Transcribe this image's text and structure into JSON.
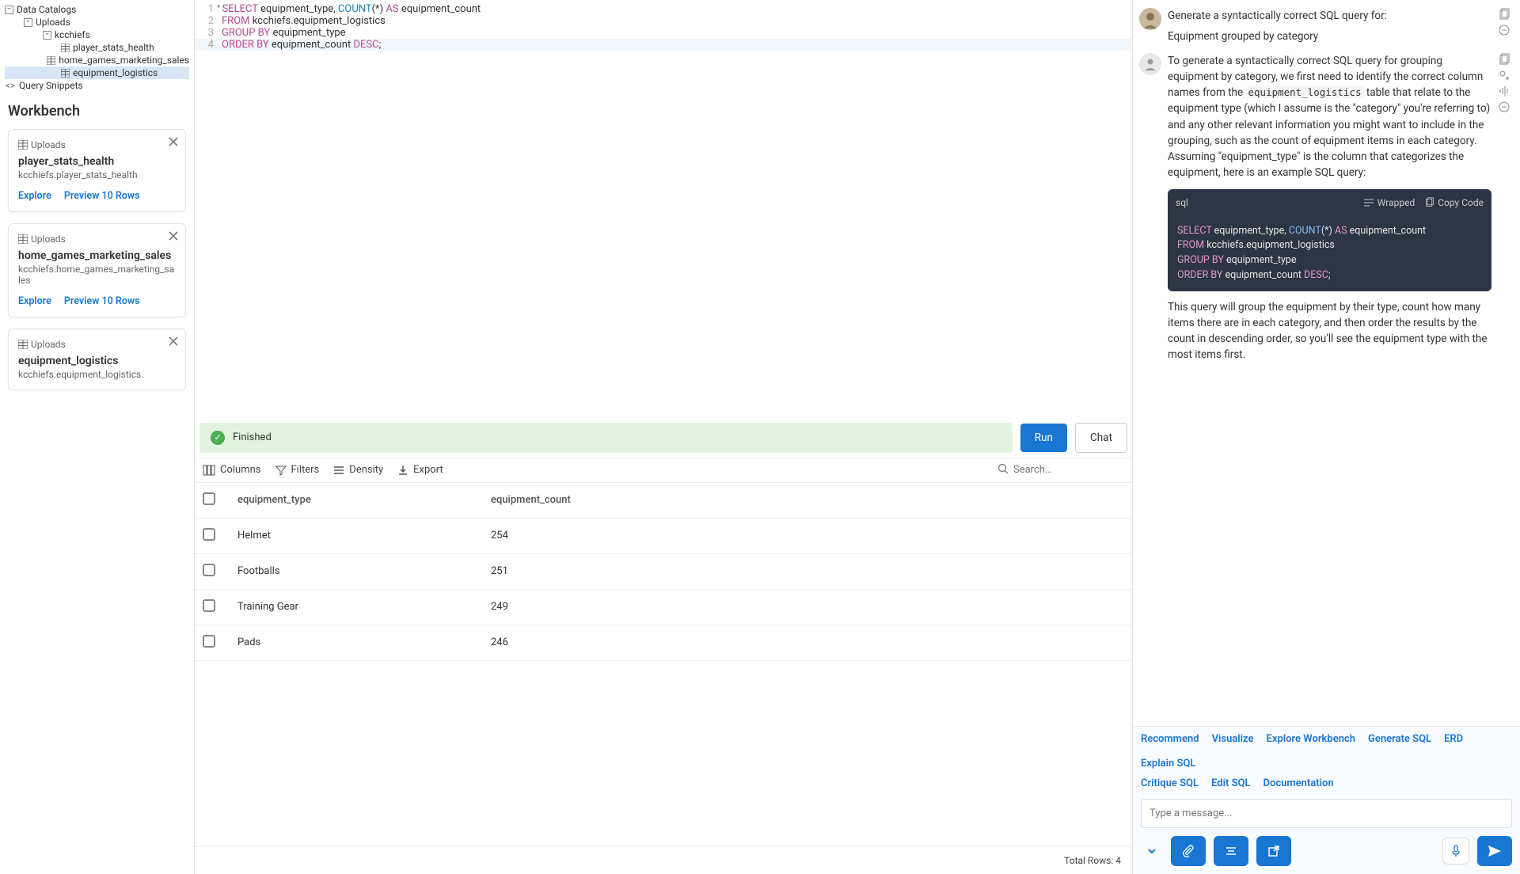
{
  "tree": {
    "root_label": "Data Catalogs",
    "l1_label": "Uploads",
    "l2_label": "kcchiefs",
    "items": [
      "player_stats_health",
      "home_games_marketing_sales",
      "equipment_logistics"
    ],
    "snippets_label": "Query Snippets"
  },
  "editor": {
    "lines": [
      {
        "n": "1",
        "html": "<span class='kw'>SELECT</span> equipment_type, <span class='fn'>COUNT</span>(*) <span class='kw'>AS</span> equipment_count"
      },
      {
        "n": "2",
        "html": "<span class='kw'>FROM</span> kcchiefs.equipment_logistics"
      },
      {
        "n": "3",
        "html": "<span class='kw'>GROUP BY</span> equipment_type"
      },
      {
        "n": "4",
        "html": "<span class='kw'>ORDER BY</span> equipment_count <span class='desc'>DESC</span>;"
      }
    ]
  },
  "status": {
    "text": "Finished",
    "run": "Run",
    "chat": "Chat"
  },
  "toolbar": {
    "columns": "Columns",
    "filters": "Filters",
    "density": "Density",
    "export": "Export",
    "search_placeholder": "Search…"
  },
  "table": {
    "headers": [
      "equipment_type",
      "equipment_count"
    ],
    "rows": [
      {
        "a": "Helmet",
        "b": "254"
      },
      {
        "a": "Footballs",
        "b": "251"
      },
      {
        "a": "Training Gear",
        "b": "249"
      },
      {
        "a": "Pads",
        "b": "246"
      }
    ],
    "total_label": "Total Rows: 4"
  },
  "workbench": {
    "title": "Workbench",
    "uploads_label": "Uploads",
    "explore": "Explore",
    "preview": "Preview 10 Rows",
    "cards": [
      {
        "name": "player_stats_health",
        "path": "kcchiefs.player_stats_health"
      },
      {
        "name": "home_games_marketing_sales",
        "path": "kcchiefs.home_games_marketing_sales"
      },
      {
        "name": "equipment_logistics",
        "path": "kcchiefs.equipment_logistics"
      }
    ]
  },
  "chat": {
    "user_line1": "Generate a syntactically correct SQL query for:",
    "user_line2": "Equipment grouped by category",
    "bot_p1_a": "To generate a syntactically correct SQL query for grouping equipment by category, we first need to identify the correct column names from the ",
    "bot_p1_code": "equipment_logistics",
    "bot_p1_b": " table that relate to the equipment type (which I assume is the \"category\" you're referring to) and any other relevant information you might want to include in the grouping, such as the count of equipment items in each category. Assuming \"equipment_type\" is the column that categorizes the equipment, here is an example SQL query:",
    "bot_p2": "This query will group the equipment by their type, count how many items there are in each category, and then order the results by the count in descending order, so you'll see the equipment type with the most items first.",
    "code_lang": "sql",
    "wrapped": "Wrapped",
    "copy": "Copy Code",
    "code_lines": [
      "<span class='ckw'>SELECT</span> equipment_type, <span class='cfn'>COUNT</span>(*) <span class='ckw'>AS</span> equipment_count",
      "<span class='ckw'>FROM</span> kcchiefs.equipment_logistics",
      "<span class='ckw'>GROUP BY</span> equipment_type",
      "<span class='ckw'>ORDER BY</span> equipment_count <span class='cdesc'>DESC</span>;"
    ],
    "links1": [
      "Recommend",
      "Visualize",
      "Explore Workbench",
      "Generate SQL",
      "ERD",
      "Explain SQL"
    ],
    "links2": [
      "Critique SQL",
      "Edit SQL",
      "Documentation"
    ],
    "input_placeholder": "Type a message..."
  }
}
